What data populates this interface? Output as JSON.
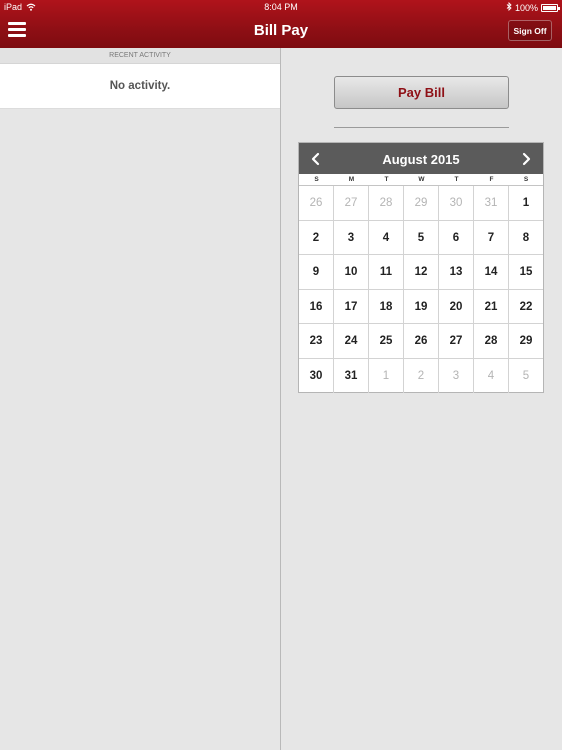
{
  "status": {
    "device": "iPad",
    "time": "8:04 PM",
    "battery": "100%",
    "battery_level": 1.0
  },
  "nav": {
    "title": "Bill Pay",
    "sign_off_label": "Sign Off"
  },
  "activity": {
    "section_title": "RECENT ACTIVITY",
    "empty_message": "No activity."
  },
  "actions": {
    "pay_bill_label": "Pay Bill"
  },
  "calendar": {
    "month_title": "August 2015",
    "day_headers": [
      "S",
      "M",
      "T",
      "W",
      "T",
      "F",
      "S"
    ],
    "weeks": [
      [
        {
          "d": "26",
          "o": true
        },
        {
          "d": "27",
          "o": true
        },
        {
          "d": "28",
          "o": true
        },
        {
          "d": "29",
          "o": true
        },
        {
          "d": "30",
          "o": true
        },
        {
          "d": "31",
          "o": true
        },
        {
          "d": "1",
          "o": false
        }
      ],
      [
        {
          "d": "2",
          "o": false
        },
        {
          "d": "3",
          "o": false
        },
        {
          "d": "4",
          "o": false
        },
        {
          "d": "5",
          "o": false
        },
        {
          "d": "6",
          "o": false
        },
        {
          "d": "7",
          "o": false
        },
        {
          "d": "8",
          "o": false
        }
      ],
      [
        {
          "d": "9",
          "o": false
        },
        {
          "d": "10",
          "o": false
        },
        {
          "d": "11",
          "o": false
        },
        {
          "d": "12",
          "o": false
        },
        {
          "d": "13",
          "o": false
        },
        {
          "d": "14",
          "o": false
        },
        {
          "d": "15",
          "o": false
        }
      ],
      [
        {
          "d": "16",
          "o": false
        },
        {
          "d": "17",
          "o": false
        },
        {
          "d": "18",
          "o": false
        },
        {
          "d": "19",
          "o": false
        },
        {
          "d": "20",
          "o": false
        },
        {
          "d": "21",
          "o": false
        },
        {
          "d": "22",
          "o": false
        }
      ],
      [
        {
          "d": "23",
          "o": false
        },
        {
          "d": "24",
          "o": false
        },
        {
          "d": "25",
          "o": false
        },
        {
          "d": "26",
          "o": false
        },
        {
          "d": "27",
          "o": false
        },
        {
          "d": "28",
          "o": false
        },
        {
          "d": "29",
          "o": false
        }
      ],
      [
        {
          "d": "30",
          "o": false
        },
        {
          "d": "31",
          "o": false
        },
        {
          "d": "1",
          "o": true
        },
        {
          "d": "2",
          "o": true
        },
        {
          "d": "3",
          "o": true
        },
        {
          "d": "4",
          "o": true
        },
        {
          "d": "5",
          "o": true
        }
      ]
    ]
  },
  "colors": {
    "brand_red": "#9a1017",
    "calendar_header": "#5b5b5b",
    "muted_day": "#b4b4b4"
  },
  "icons": {
    "menu": "hamburger-menu-icon",
    "prev": "chevron-left-icon",
    "next": "chevron-right-icon",
    "wifi": "wifi-icon",
    "bluetooth": "bluetooth-icon",
    "battery": "battery-icon"
  }
}
